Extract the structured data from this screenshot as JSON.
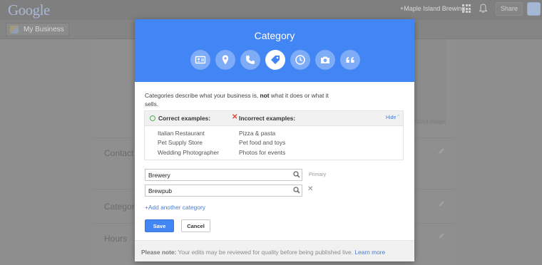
{
  "topbar": {
    "logo": "Google",
    "user": "+Maple Island Brewing",
    "share": "Share"
  },
  "subbar": {
    "my_business": "My Business"
  },
  "background": {
    "contact": "Contact",
    "category": "Category",
    "hours": "Hours",
    "map_copyright": "©2014 Google"
  },
  "dialog": {
    "title": "Category",
    "steps": [
      "contact-card-icon",
      "location-pin-icon",
      "phone-icon",
      "tag-icon",
      "clock-icon",
      "camera-icon",
      "quote-icon"
    ],
    "description_pre": "Categories describe what your business is, ",
    "description_bold": "not",
    "description_post": " what it does or what it sells.",
    "examples": {
      "correct_title": "Correct examples:",
      "incorrect_title": "Incorrect examples:",
      "hide": "Hide",
      "correct": [
        "Italian Restaurant",
        "Pet Supply Store",
        "Wedding Photographer"
      ],
      "incorrect": [
        "Pizza & pasta",
        "Pet food and toys",
        "Photos for events"
      ]
    },
    "categories": [
      {
        "value": "Brewery",
        "tag": "Primary"
      },
      {
        "value": "Brewpub",
        "tag": ""
      }
    ],
    "add_link": "+Add another category",
    "save": "Save",
    "cancel": "Cancel",
    "note_label": "Please note:",
    "note_text": " Your edits may be reviewed for quality before being published live. ",
    "learn_more": "Learn more"
  },
  "colors": {
    "header_blue": "#4285f4",
    "link_blue": "#4a7bd0",
    "error_red": "#dd4b39",
    "ok_green": "#4caf50"
  }
}
